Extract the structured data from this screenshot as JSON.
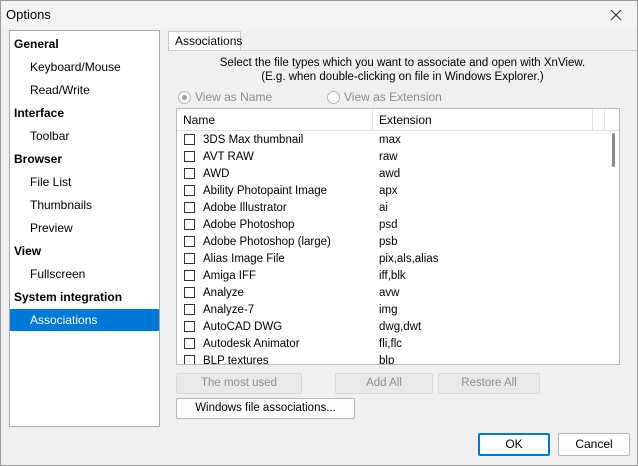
{
  "window": {
    "title": "Options"
  },
  "tree": {
    "items": [
      {
        "label": "General",
        "type": "group"
      },
      {
        "label": "Keyboard/Mouse",
        "type": "leaf"
      },
      {
        "label": "Read/Write",
        "type": "leaf"
      },
      {
        "label": "Interface",
        "type": "group"
      },
      {
        "label": "Toolbar",
        "type": "leaf"
      },
      {
        "label": "Browser",
        "type": "group"
      },
      {
        "label": "File List",
        "type": "leaf"
      },
      {
        "label": "Thumbnails",
        "type": "leaf"
      },
      {
        "label": "Preview",
        "type": "leaf"
      },
      {
        "label": "View",
        "type": "group"
      },
      {
        "label": "Fullscreen",
        "type": "leaf"
      },
      {
        "label": "System integration",
        "type": "group"
      },
      {
        "label": "Associations",
        "type": "leaf",
        "selected": true
      }
    ]
  },
  "tab": {
    "label": "Associations"
  },
  "description": {
    "line1": "Select the file types which you want to associate and open with XnView.",
    "line2": "(E.g. when double-clicking on file in Windows Explorer.)"
  },
  "view_mode": {
    "name_label": "View as Name",
    "extension_label": "View as Extension",
    "selected": "name"
  },
  "list": {
    "columns": {
      "name": "Name",
      "extension": "Extension"
    },
    "rows": [
      {
        "name": "3DS Max thumbnail",
        "ext": "max"
      },
      {
        "name": "AVT RAW",
        "ext": "raw"
      },
      {
        "name": "AWD",
        "ext": "awd"
      },
      {
        "name": "Ability Photopaint Image",
        "ext": "apx"
      },
      {
        "name": "Adobe Illustrator",
        "ext": "ai"
      },
      {
        "name": "Adobe Photoshop",
        "ext": "psd"
      },
      {
        "name": "Adobe Photoshop (large)",
        "ext": "psb"
      },
      {
        "name": "Alias Image File",
        "ext": "pix,als,alias"
      },
      {
        "name": "Amiga IFF",
        "ext": "iff,blk"
      },
      {
        "name": "Analyze",
        "ext": "avw"
      },
      {
        "name": "Analyze-7",
        "ext": "img"
      },
      {
        "name": "AutoCAD DWG",
        "ext": "dwg,dwt"
      },
      {
        "name": "Autodesk Animator",
        "ext": "fli,flc"
      },
      {
        "name": "BLP textures",
        "ext": "blp"
      }
    ]
  },
  "actions": {
    "most_used": "The most used",
    "add_all": "Add All",
    "restore_all": "Restore All",
    "windows_assoc": "Windows file associations..."
  },
  "dialog": {
    "ok": "OK",
    "cancel": "Cancel"
  }
}
